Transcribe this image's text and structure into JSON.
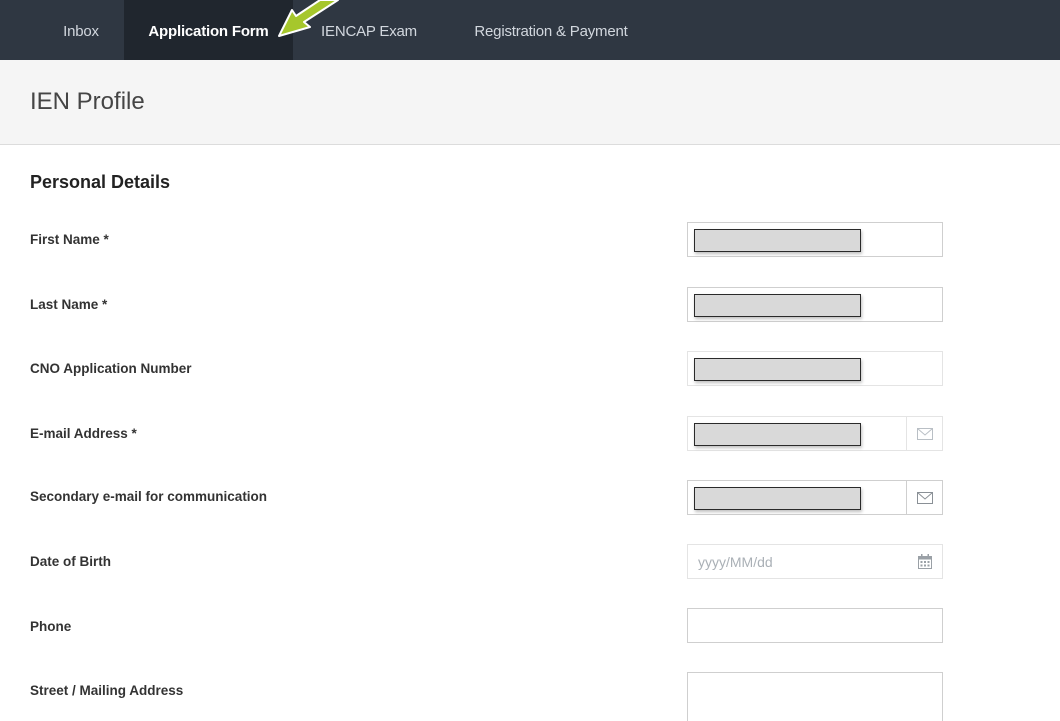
{
  "nav": {
    "items": [
      {
        "label": "Inbox",
        "active": false
      },
      {
        "label": "Application Form",
        "active": true
      },
      {
        "label": "IENCAP Exam",
        "active": false
      },
      {
        "label": "Registration & Payment",
        "active": false
      }
    ]
  },
  "page": {
    "title": "IEN Profile",
    "section_title": "Personal Details"
  },
  "fields": [
    {
      "label": "First Name *",
      "value": "",
      "redacted": true
    },
    {
      "label": "Last Name *",
      "value": "",
      "redacted": true
    },
    {
      "label": "CNO Application Number",
      "value": "",
      "redacted": true
    },
    {
      "label": "E-mail Address *",
      "value": "",
      "redacted": true,
      "addon_icon": "envelope-icon"
    },
    {
      "label": "Secondary e-mail for communication",
      "value": "",
      "redacted": true,
      "addon_icon": "envelope-icon"
    },
    {
      "label": "Date of Birth",
      "value": "",
      "placeholder": "yyyy/MM/dd",
      "addon_icon": "calendar-icon"
    },
    {
      "label": "Phone",
      "value": ""
    },
    {
      "label": "Street / Mailing Address",
      "value": ""
    }
  ],
  "colors": {
    "topbar": "#2f3742",
    "topbar_active": "#20262e",
    "arrow": "#a6c72c",
    "header_band": "#f5f5f5"
  }
}
